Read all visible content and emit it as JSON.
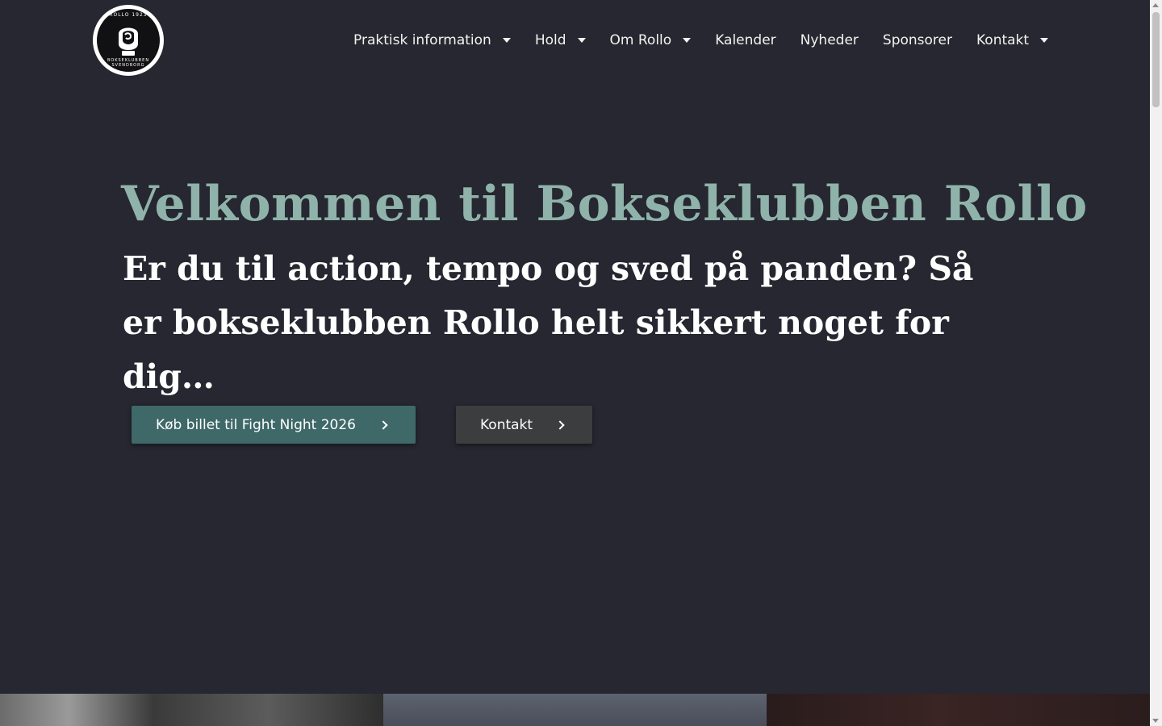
{
  "header": {
    "logo": {
      "top_text": "ROLLO 1923",
      "bottom_text": "BOKSEKLUBBEN SVENDBORG",
      "icon": "boxing-glove-icon"
    },
    "nav": [
      {
        "label": "Praktisk information",
        "has_dropdown": true
      },
      {
        "label": "Hold",
        "has_dropdown": true
      },
      {
        "label": "Om Rollo",
        "has_dropdown": true
      },
      {
        "label": "Kalender",
        "has_dropdown": false
      },
      {
        "label": "Nyheder",
        "has_dropdown": false
      },
      {
        "label": "Sponsorer",
        "has_dropdown": false
      },
      {
        "label": "Kontakt",
        "has_dropdown": true
      }
    ]
  },
  "hero": {
    "title": "Velkommen til Bokseklubben Rollo",
    "subtitle": "Er du til action, tempo og sved på panden? Så er bokseklubben Rollo helt sikkert noget for dig…",
    "primary_button": "Køb billet til Fight Night 2026",
    "secondary_button": "Kontakt"
  },
  "colors": {
    "background": "#262730",
    "title_accent": "#8fb3aa",
    "primary_button": "#3f6868",
    "secondary_button": "#3b3d3f"
  }
}
